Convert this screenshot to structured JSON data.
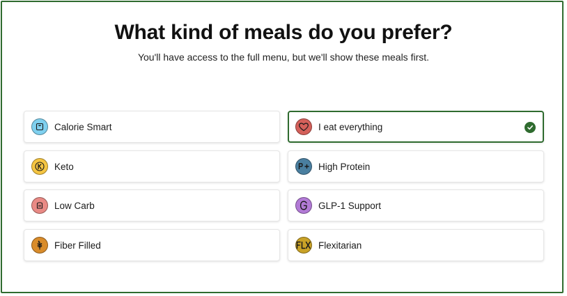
{
  "header": {
    "title": "What kind of meals do you prefer?",
    "subtitle": "You'll have access to the full menu, but we'll show these meals first."
  },
  "options": [
    {
      "label": "Calorie Smart",
      "icon": "scale-icon",
      "color": "#7fd0ef",
      "selected": false
    },
    {
      "label": "I eat everything",
      "icon": "heart-icon",
      "color": "#d4605a",
      "selected": true
    },
    {
      "label": "Keto",
      "icon": "keto-k-icon",
      "color": "#f5c542",
      "selected": false
    },
    {
      "label": "High Protein",
      "icon": "protein-plus-icon",
      "color": "#4a7fa0",
      "selected": false
    },
    {
      "label": "Low Carb",
      "icon": "low-carb-icon",
      "color": "#e98a85",
      "selected": false
    },
    {
      "label": "GLP-1 Support",
      "icon": "glp1-g-icon",
      "color": "#b27ad6",
      "selected": false
    },
    {
      "label": "Fiber Filled",
      "icon": "wheat-icon",
      "color": "#d98c2b",
      "selected": false
    },
    {
      "label": "Flexitarian",
      "icon": "flx-icon",
      "color": "#c9a227",
      "selected": false
    }
  ],
  "selection_color": "#2f6b2f"
}
